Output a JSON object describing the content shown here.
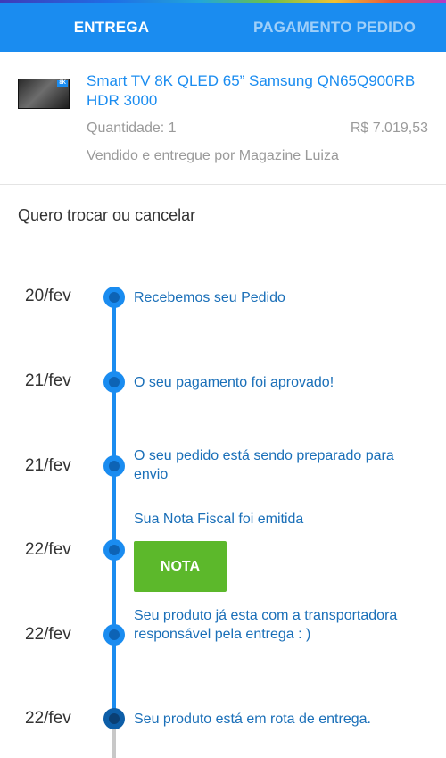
{
  "tabs": {
    "delivery": "ENTREGA",
    "payment": "PAGAMENTO PEDIDO"
  },
  "product": {
    "name": "Smart TV 8K QLED 65” Samsung QN65Q900RB HDR 3000",
    "thumb_badge": "8K",
    "quantity": "Quantidade: 1",
    "price": "R$ 7.019,53",
    "seller": "Vendido e entregue por Magazine Luiza"
  },
  "exchange_link": "Quero trocar ou cancelar",
  "timeline": [
    {
      "date": "20/fev",
      "text": "Recebemos seu Pedido"
    },
    {
      "date": "21/fev",
      "text": "O seu pagamento foi aprovado!"
    },
    {
      "date": "21/fev",
      "text": "O seu pedido está sendo preparado para envio"
    },
    {
      "date": "22/fev",
      "text": "Sua Nota Fiscal foi emitida",
      "button": "NOTA"
    },
    {
      "date": "22/fev",
      "text": "Seu produto já esta com a transportadora responsável pela entrega : )"
    },
    {
      "date": "22/fev",
      "text": "Seu produto está em rota de entrega."
    }
  ],
  "colors": {
    "primary": "#1a8cf0",
    "nota_button": "#5cb82b",
    "muted_text": "#9a9a9a"
  }
}
